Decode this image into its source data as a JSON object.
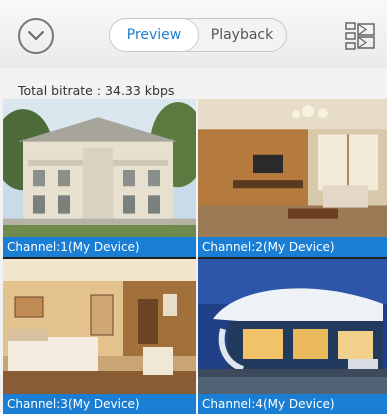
{
  "header": {
    "tabs": [
      {
        "label": "Preview",
        "active": true
      },
      {
        "label": "Playback",
        "active": false
      }
    ],
    "icons": {
      "back": "chevron-down-circle-icon",
      "layout": "layout-list-icon"
    }
  },
  "status": {
    "bitrate_text": "Total bitrate : 34.33 kbps"
  },
  "channels": [
    {
      "label": "Channel:1(My Device)"
    },
    {
      "label": "Channel:2(My Device)"
    },
    {
      "label": "Channel:3(My Device)"
    },
    {
      "label": "Channel:4(My Device)"
    }
  ],
  "colors": {
    "accent": "#1e7fd0",
    "caption_bg": "#1a7fd4"
  }
}
